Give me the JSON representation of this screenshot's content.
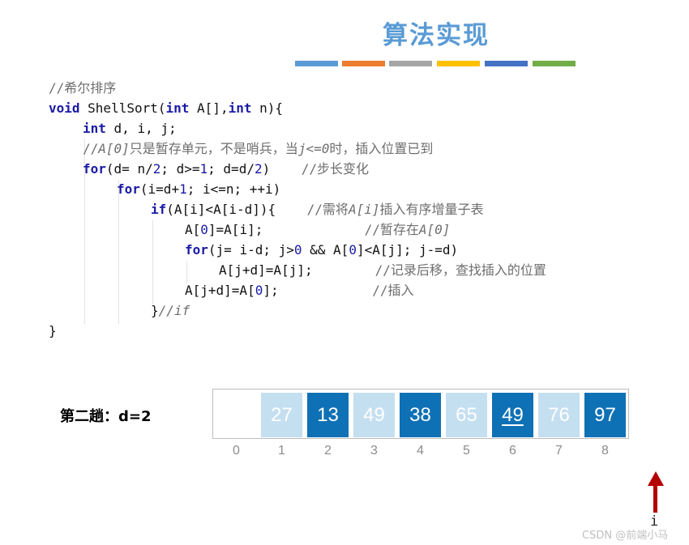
{
  "title": "算法实现",
  "color_bar": [
    "#5b9bd5",
    "#ed7d31",
    "#a5a5a5",
    "#ffc000",
    "#4472c4",
    "#70ad47"
  ],
  "code": {
    "line1": "//希尔排序",
    "line2": {
      "kw1": "void",
      "t1": " ShellSort(",
      "kw2": "int",
      "t2": " A[],",
      "kw3": "int",
      "t3": " n){"
    },
    "line3": {
      "kw": "int",
      "t": " d, i, j;"
    },
    "line4": {
      "c1": "//",
      "c2": "A[0]",
      "c3": "只是暂存单元，不是哨兵，当",
      "c4": "j<=0",
      "c5": "时，插入位置已到"
    },
    "line5": {
      "kw": "for",
      "t1": "(d= n/",
      "n1": "2",
      "t2": "; d>=",
      "n2": "1",
      "t3": "; d=d/",
      "n3": "2",
      "t4": ")    ",
      "c": "//步长变化"
    },
    "line6": {
      "kw": "for",
      "t1": "(i=d+",
      "n1": "1",
      "t2": "; i<=n; ++i)"
    },
    "line7": {
      "kw": "if",
      "t": "(A[i]<A[i-d]){    ",
      "c1": "//需将",
      "c2": "A[i]",
      "c3": "插入有序增量子表"
    },
    "line8": {
      "t1": "A[",
      "n1": "0",
      "t2": "]=A[i];             ",
      "c1": "//暂存在",
      "c2": "A[0]"
    },
    "line9": {
      "kw": "for",
      "t1": "(j= i-d; j>",
      "n1": "0",
      "t2": " && A[",
      "n2": "0",
      "t3": "]<A[j]; j-=d)"
    },
    "line10": {
      "t": "A[j+d]=A[j];        ",
      "c": "//记录后移，查找插入的位置"
    },
    "line11": {
      "t1": "A[j+d]=A[",
      "n1": "0",
      "t2": "];            ",
      "c": "//插入"
    },
    "line12": {
      "t": "}",
      "c": "//if"
    },
    "line13": "}"
  },
  "pass_label": "第二趟：d=2",
  "array": {
    "values": [
      "",
      "27",
      "13",
      "49",
      "38",
      "65",
      "49",
      "76",
      "97"
    ],
    "indices": [
      "0",
      "1",
      "2",
      "3",
      "4",
      "5",
      "6",
      "7",
      "8"
    ]
  },
  "pointer_label": "i",
  "watermark": "CSDN @前端小马"
}
